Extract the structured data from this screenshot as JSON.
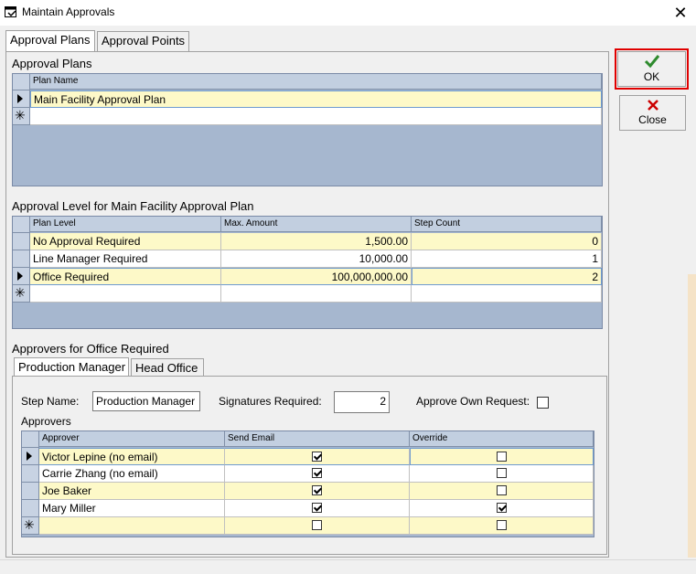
{
  "window": {
    "title": "Maintain Approvals",
    "close_glyph": "✕"
  },
  "tabs": [
    {
      "label": "Approval Plans",
      "active": true
    },
    {
      "label": "Approval Points",
      "active": false
    }
  ],
  "buttons": {
    "ok_label": "OK",
    "close_label": "Close"
  },
  "approval_plans": {
    "heading": "Approval Plans",
    "columns": [
      "Plan Name"
    ],
    "rows": [
      {
        "plan_name": "Main Facility Approval Plan",
        "current": true
      }
    ],
    "new_row_glyph": "✳"
  },
  "approval_levels": {
    "heading": "Approval Level for Main Facility Approval Plan",
    "columns": [
      "Plan Level",
      "Max. Amount",
      "Step Count"
    ],
    "rows": [
      {
        "level": "No Approval Required",
        "max_amount": "1,500.00",
        "step_count": "0",
        "current": false
      },
      {
        "level": "Line Manager Required",
        "max_amount": "10,000.00",
        "step_count": "1",
        "current": false
      },
      {
        "level": "Office Required",
        "max_amount": "100,000,000.00",
        "step_count": "2",
        "current": true
      }
    ]
  },
  "approvers_section": {
    "heading": "Approvers for Office Required",
    "step_tabs": [
      {
        "label": "Production Manager",
        "active": true
      },
      {
        "label": "Head Office",
        "active": false
      }
    ],
    "step_name_label": "Step Name:",
    "step_name_value": "Production Manager",
    "signatures_label": "Signatures Required:",
    "signatures_value": "2",
    "approve_own_label": "Approve Own Request:",
    "approve_own_checked": false,
    "approvers_label": "Approvers",
    "columns": [
      "Approver",
      "Send Email",
      "Override"
    ],
    "rows": [
      {
        "approver": "Victor Lepine (no email)",
        "send_email": true,
        "override": false,
        "current": true
      },
      {
        "approver": "Carrie Zhang (no email)",
        "send_email": true,
        "override": false,
        "current": false
      },
      {
        "approver": "Joe Baker",
        "send_email": true,
        "override": false,
        "current": false
      },
      {
        "approver": "Mary Miller",
        "send_email": true,
        "override": true,
        "current": false
      },
      {
        "approver": "",
        "send_email": false,
        "override": false,
        "current": false,
        "new_row": true
      }
    ]
  },
  "icons": {
    "window_icon": "app-window-icon",
    "ok_icon": "checkmark-icon",
    "close_icon": "red-x-icon",
    "ok_color": "#2e8b2e",
    "close_color": "#cc0000",
    "highlight_border": "#e00000"
  }
}
